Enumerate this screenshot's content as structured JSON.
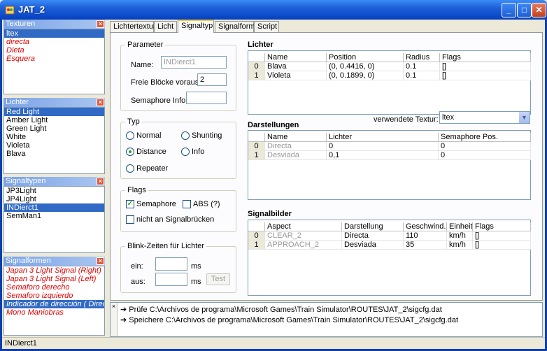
{
  "window": {
    "title": "JAT_2",
    "minimize": "_",
    "maximize": "□",
    "close": "✕"
  },
  "panels": {
    "texturen": {
      "title": "Texturen",
      "items": [
        "ltex",
        "directa",
        "Dieta",
        "Esquera"
      ]
    },
    "lichter": {
      "title": "Lichter",
      "items": [
        "Red Light",
        "Amber Light",
        "Green Light",
        "White",
        "Violeta",
        "Blava"
      ]
    },
    "signaltypen": {
      "title": "Signaltypen",
      "items": [
        "JP3Light",
        "JP4Light",
        "INDierct1",
        "SemMan1"
      ]
    },
    "signalformen": {
      "title": "Signalformen",
      "items": [
        "Japan 3 Light Signal (Right)",
        "Japan 3 Light Signal (Left)",
        "Semaforo derecho",
        "Semaforo izquierdo",
        "Indicador de dirección ( Directa",
        "Mono Maniobras"
      ]
    }
  },
  "tabs": [
    "Lichtertextur",
    "Licht",
    "Signaltyp",
    "Signalform",
    "Script"
  ],
  "parameter": {
    "title": "Parameter",
    "name_label": "Name:",
    "name_value": "INDierct1",
    "freie_label": "Freie Blöcke voraus:",
    "freie_value": "2",
    "semaphore_label": "Semaphore Info:",
    "semaphore_value": ""
  },
  "typ": {
    "title": "Typ",
    "normal": "Normal",
    "shunting": "Shunting",
    "distance": "Distance",
    "info": "Info",
    "repeater": "Repeater"
  },
  "flags": {
    "title": "Flags",
    "semaphore": "Semaphore",
    "abs": "ABS (?)",
    "nicht": "nicht an Signalbrücken"
  },
  "blink": {
    "title": "Blink-Zeiten für Lichter",
    "ein": "ein:",
    "aus": "aus:",
    "ms1": "ms",
    "ms2": "ms",
    "test": "Test"
  },
  "lichter_table": {
    "title": "Lichter",
    "headers": [
      "Name",
      "Position",
      "Radius",
      "Flags"
    ],
    "rows": [
      {
        "idx": "0",
        "name": "Blava",
        "position": "(0, 0.4416, 0)",
        "radius": "0.1",
        "flags": "[]"
      },
      {
        "idx": "1",
        "name": "Violeta",
        "position": "(0, 0.1899, 0)",
        "radius": "0.1",
        "flags": "[]"
      }
    ]
  },
  "darstellungen": {
    "title": "Darstellungen",
    "textur_label": "verwendete Textur:",
    "textur_value": "ltex",
    "headers": [
      "Name",
      "Lichter",
      "Semaphore Pos."
    ],
    "rows": [
      {
        "idx": "0",
        "name": "Directa",
        "lichter": "0",
        "sem": "0"
      },
      {
        "idx": "1",
        "name": "Desviada",
        "lichter": "0,1",
        "sem": "0"
      }
    ]
  },
  "signalbilder": {
    "title": "Signalbilder",
    "headers": [
      "Aspect",
      "Darstellung",
      "Geschwind.",
      "Einheit",
      "Flags"
    ],
    "rows": [
      {
        "idx": "0",
        "aspect": "CLEAR_2",
        "darstellung": "Directa",
        "speed": "110",
        "unit": "km/h",
        "flags": "[]"
      },
      {
        "idx": "1",
        "aspect": "APPROACH_2",
        "darstellung": "Desviada",
        "speed": "35",
        "unit": "km/h",
        "flags": "[]"
      }
    ]
  },
  "log": [
    "Prüfe C:\\Archivos de programa\\Microsoft Games\\Train Simulator\\ROUTES\\JAT_2\\sigcfg.dat",
    "Speichere C:\\Archivos de programa\\Microsoft Games\\Train Simulator\\ROUTES\\JAT_2\\sigcfg.dat"
  ],
  "status": "INDierct1",
  "colors": {
    "selection": "#316AC5",
    "titlebar": "#0B48C9",
    "italic_red": "#e00000"
  }
}
